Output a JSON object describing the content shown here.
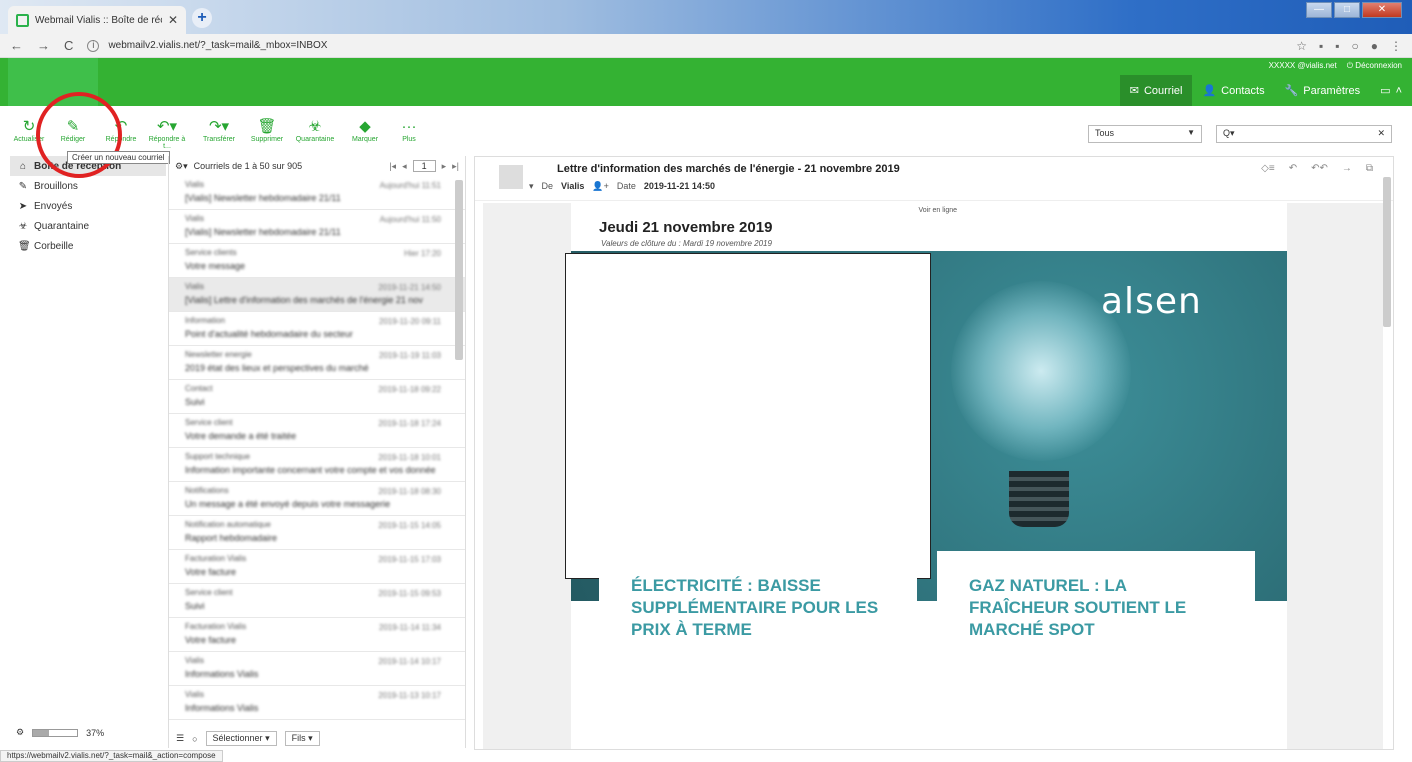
{
  "browser": {
    "tab_title": "Webmail Vialis :: Boîte de récept",
    "url": "webmailv2.vialis.net/?_task=mail&_mbox=INBOX",
    "status_url": "https://webmailv2.vialis.net/?_task=mail&_action=compose"
  },
  "header": {
    "user": "XXXXX @vialis.net",
    "logout": "Déconnexion",
    "nav": [
      {
        "label": "Courriel",
        "icon": "envelope-icon"
      },
      {
        "label": "Contacts",
        "icon": "person-icon"
      },
      {
        "label": "Paramètres",
        "icon": "wrench-icon"
      }
    ]
  },
  "toolbar": {
    "buttons": [
      "Actualiser",
      "Rédiger",
      "Répondre",
      "Répondre à t...",
      "Transférer",
      "Supprimer",
      "Quarantaine",
      "Marquer",
      "Plus"
    ],
    "tooltip": "Créer un nouveau courriel",
    "filter_value": "Tous",
    "search_placeholder": "Q▾"
  },
  "folders": [
    {
      "label": "Boîte de réception",
      "icon": "inbox-icon"
    },
    {
      "label": "Brouillons",
      "icon": "pencil-icon"
    },
    {
      "label": "Envoyés",
      "icon": "paper-plane-icon"
    },
    {
      "label": "Quarantaine",
      "icon": "quarantine-icon"
    },
    {
      "label": "Corbeille",
      "icon": "trash-icon"
    }
  ],
  "quota": {
    "percent": 37,
    "label": "37%"
  },
  "msglist": {
    "count_label": "Courriels de 1 à 50 sur 905",
    "page": "1",
    "select_label": "Sélectionner",
    "threads_label": "Fils",
    "messages": [
      {
        "from": "Vialis",
        "date": "Aujourd'hui 11:51",
        "subject": "[Vialis] Newsletter hebdomadaire 21/11"
      },
      {
        "from": "Vialis",
        "date": "Aujourd'hui 11:50",
        "subject": "[Vialis] Newsletter hebdomadaire 21/11"
      },
      {
        "from": "Service clients",
        "date": "Hier 17:20",
        "subject": "Votre message"
      },
      {
        "from": "Vialis",
        "date": "2019-11-21 14:50",
        "subject": "[Vialis] Lettre d'information des marchés de l'énergie 21 nov"
      },
      {
        "from": "Information",
        "date": "2019-11-20 09:11",
        "subject": "Point d'actualité hebdomadaire du secteur"
      },
      {
        "from": "Newsletter energie",
        "date": "2019-11-19 11:03",
        "subject": "2019 état des lieux et perspectives du marché"
      },
      {
        "from": "Contact",
        "date": "2019-11-18 09:22",
        "subject": "Suivi"
      },
      {
        "from": "Service client",
        "date": "2019-11-18 17:24",
        "subject": "Votre demande a été traitée"
      },
      {
        "from": "Support technique",
        "date": "2019-11-18 10:01",
        "subject": "Information importante concernant votre compte et vos données"
      },
      {
        "from": "Notifications",
        "date": "2019-11-18 08:30",
        "subject": "Un message a été envoyé depuis votre messagerie"
      },
      {
        "from": "Notification automatique",
        "date": "2019-11-15 14:05",
        "subject": "Rapport hebdomadaire"
      },
      {
        "from": "Facturation Vialis",
        "date": "2019-11-15 17:03",
        "subject": "Votre facture"
      },
      {
        "from": "Service client",
        "date": "2019-11-15 09:53",
        "subject": "Suivi"
      },
      {
        "from": "Facturation Vialis",
        "date": "2019-11-14 11:34",
        "subject": "Votre facture"
      },
      {
        "from": "Vialis",
        "date": "2019-11-14 10:17",
        "subject": "Informations Vialis"
      },
      {
        "from": "Vialis",
        "date": "2019-11-13 10:17",
        "subject": "Informations Vialis"
      }
    ]
  },
  "preview": {
    "subject": "Lettre d'information des marchés de l'énergie - 21 novembre 2019",
    "from_label": "De",
    "from": "Vialis",
    "date_label": "Date",
    "date": "2019-11-21 14:50",
    "voir_en_ligne": "Voir en ligne",
    "nl_date": "Jeudi 21 novembre 2019",
    "nl_sub": "Valeurs de clôture du : Mardi 19 novembre 2019",
    "brand": "alsen",
    "card_left": "ÉLECTRICITÉ : BAISSE SUPPLÉMENTAIRE POUR LES PRIX À TERME",
    "card_right": "GAZ NATUREL : LA FRAÎCHEUR SOUTIENT LE MARCHÉ SPOT"
  }
}
